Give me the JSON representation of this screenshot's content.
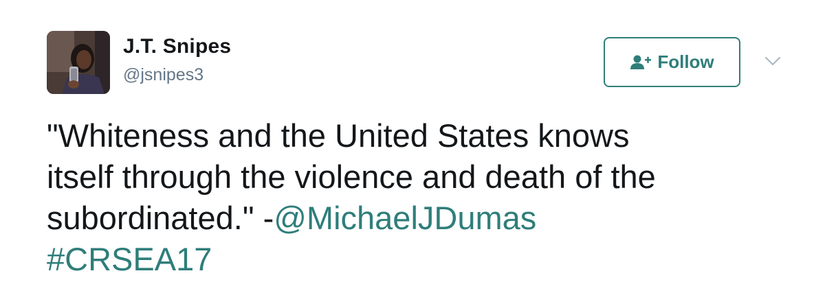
{
  "user": {
    "display_name": "J.T. Snipes",
    "handle": "@jsnipes3"
  },
  "follow_button": {
    "label": "Follow",
    "icon": "add-user-icon"
  },
  "menu": {
    "icon": "chevron-down-icon"
  },
  "tweet": {
    "text_line1": "\"Whiteness and the United States knows",
    "text_line2": "itself through the violence and death of the",
    "text_line3_prefix": "subordinated.\" -",
    "mention": "@MichaelJDumas",
    "hashtag": "#CRSEA17"
  },
  "colors": {
    "accent": "#2f7e7a",
    "text": "#14171a",
    "secondary_text": "#657786"
  }
}
